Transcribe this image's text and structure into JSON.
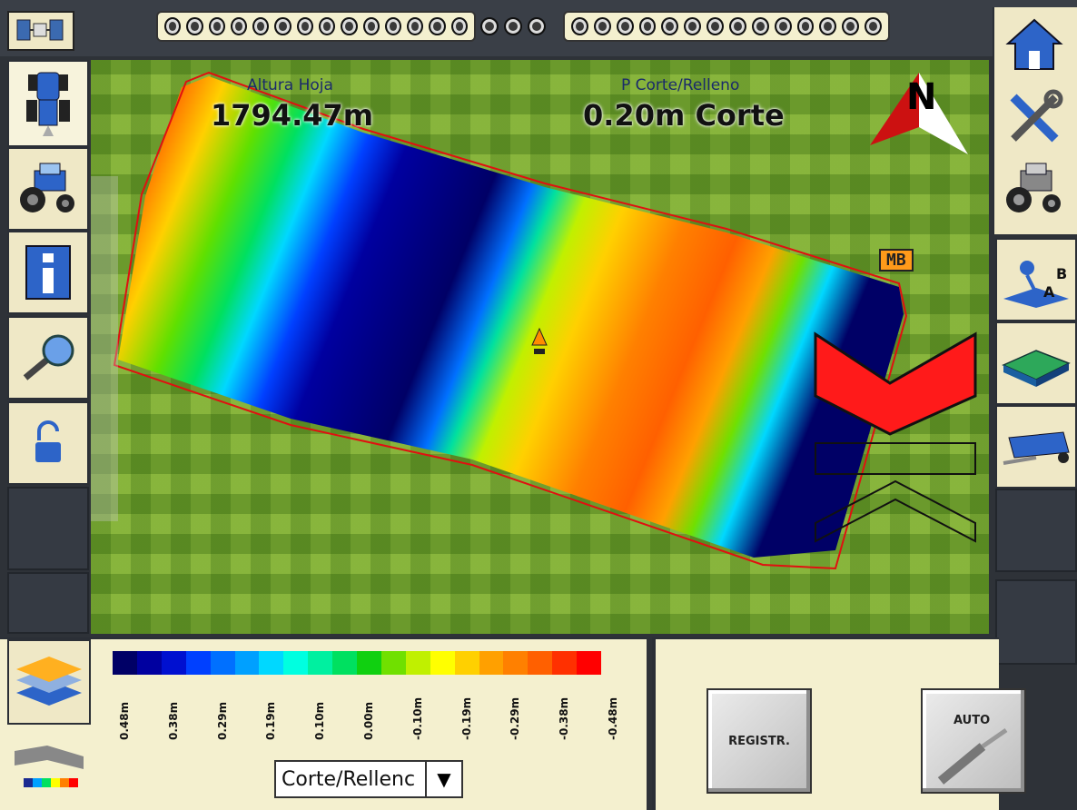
{
  "gps_icon": "satellite-icon",
  "leds": {
    "left_count": 14,
    "middle_count": 3,
    "right_count": 14
  },
  "overlay": {
    "leaf_height_label": "Altura Hoja",
    "leaf_height_value": "1794.47m",
    "cut_fill_label": "P Corte/Relleno",
    "cut_fill_value": "0.20m Corte",
    "compass_letter": "N",
    "marker_label": "MB"
  },
  "legend": {
    "colors": [
      "#000066",
      "#0000a0",
      "#0010d0",
      "#0040ff",
      "#0070ff",
      "#00a0ff",
      "#00d8ff",
      "#00ffe0",
      "#00f0a0",
      "#00e060",
      "#10d010",
      "#70e000",
      "#c0f000",
      "#ffff00",
      "#ffd000",
      "#ffa000",
      "#ff8000",
      "#ff6000",
      "#ff3000",
      "#ff0000"
    ],
    "labels": [
      "0.48m",
      "0.38m",
      "0.29m",
      "0.19m",
      "0.10m",
      "0.00m",
      "-0.10m",
      "-0.19m",
      "-0.29m",
      "-0.38m",
      "-0.48m"
    ]
  },
  "mode_select": {
    "value": "Corte/Rellenc"
  },
  "buttons": {
    "record_label": "REGISTR.",
    "auto_label": "AUTO"
  }
}
